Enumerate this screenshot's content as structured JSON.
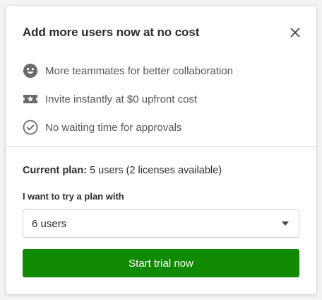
{
  "dialog": {
    "title": "Add more users now at no cost",
    "close_icon": "close-icon"
  },
  "features": [
    {
      "icon": "smiley-face-icon",
      "text": "More teammates for better collaboration"
    },
    {
      "icon": "ticket-star-icon",
      "text": "Invite instantly at $0 upfront cost"
    },
    {
      "icon": "check-circle-icon",
      "text": "No waiting time for approvals"
    }
  ],
  "plan": {
    "current_label": "Current plan:",
    "current_value": "5 users (2 licenses available)",
    "select_label": "I want to try a plan with",
    "selected_option": "6 users"
  },
  "cta": {
    "label": "Start trial now"
  },
  "colors": {
    "primary": "#108a00",
    "icon": "#6b6b6b",
    "text": "#2d2d2d",
    "muted_text": "#555555",
    "border": "#cfcfcf"
  }
}
